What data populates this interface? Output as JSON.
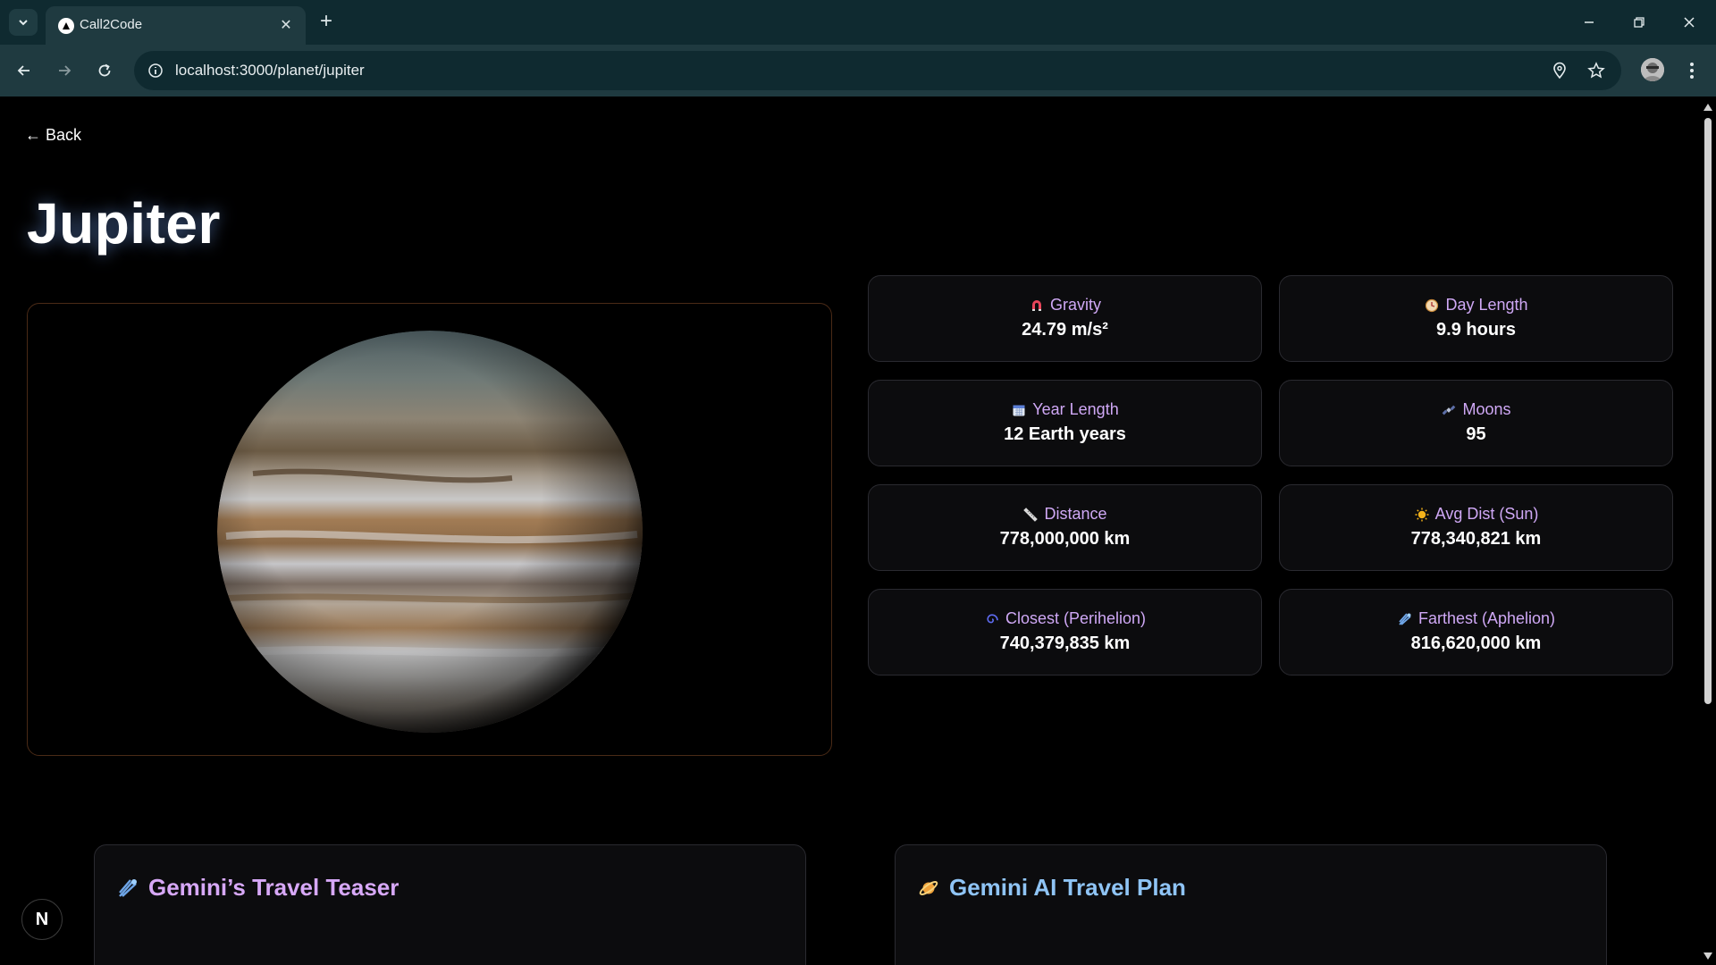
{
  "browser": {
    "tab_title": "Call2Code",
    "url": "localhost:3000/planet/jupiter"
  },
  "page": {
    "back_label": "← Back",
    "title": "Jupiter"
  },
  "stats": [
    {
      "icon": "magnet-icon",
      "label": "Gravity",
      "value": "24.79 m/s²"
    },
    {
      "icon": "clock-icon",
      "label": "Day Length",
      "value": "9.9 hours"
    },
    {
      "icon": "calendar-icon",
      "label": "Year Length",
      "value": "12 Earth years"
    },
    {
      "icon": "satellite-icon",
      "label": "Moons",
      "value": "95"
    },
    {
      "icon": "ruler-icon",
      "label": "Distance",
      "value": "778,000,000 km"
    },
    {
      "icon": "sun-icon",
      "label": "Avg Dist (Sun)",
      "value": "778,340,821 km"
    },
    {
      "icon": "spiral-icon",
      "label": "Closest (Perihelion)",
      "value": "740,379,835 km"
    },
    {
      "icon": "comet-icon",
      "label": "Farthest (Aphelion)",
      "value": "816,620,000 km"
    }
  ],
  "panels": {
    "teaser_title": "Gemini’s Travel Teaser",
    "plan_title": "Gemini AI Travel Plan"
  },
  "colors": {
    "stat_label": "#cfa8f5",
    "teaser_title": "#d7a8f7",
    "plan_title": "#8fc4f5"
  },
  "badge": "N"
}
